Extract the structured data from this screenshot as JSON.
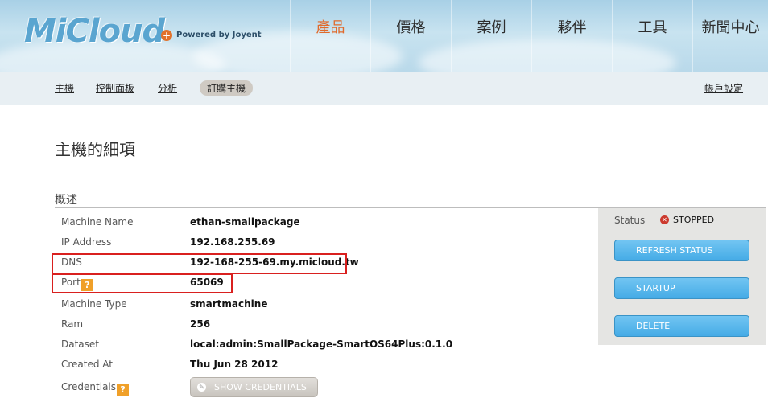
{
  "brand": {
    "logo_text": "MiCloud",
    "powered_by": "Powered by Joyent",
    "accent": "#e06a2c"
  },
  "nav": [
    {
      "label": "產品",
      "active": true
    },
    {
      "label": "價格",
      "active": false
    },
    {
      "label": "案例",
      "active": false
    },
    {
      "label": "夥伴",
      "active": false
    },
    {
      "label": "工具",
      "active": false
    },
    {
      "label": "新聞中心",
      "active": false
    }
  ],
  "subnav": {
    "machines": "主機",
    "control_panel": "控制面板",
    "analytics": "分析",
    "order_machine": "訂購主機",
    "account_settings": "帳戶設定"
  },
  "page": {
    "title": "主機的細項",
    "section": "概述"
  },
  "details": [
    {
      "label": "Machine Name",
      "value": "ethan-smallpackage"
    },
    {
      "label": "IP Address",
      "value": "192.168.255.69"
    },
    {
      "label": "DNS",
      "value": "192-168-255-69.my.micloud.tw"
    },
    {
      "label": "Port",
      "value": "65069",
      "help": "?"
    },
    {
      "label": "Machine Type",
      "value": "smartmachine"
    },
    {
      "label": "Ram",
      "value": "256"
    },
    {
      "label": "Dataset",
      "value": "local:admin:SmallPackage-SmartOS64Plus:0.1.0"
    },
    {
      "label": "Created At",
      "value": "Thu Jun 28 2012"
    },
    {
      "label": "Credentials",
      "help": "?"
    }
  ],
  "credentials_button": "SHOW CREDENTIALS",
  "status": {
    "label": "Status",
    "value": "STOPPED",
    "color": "#cc3a2e",
    "buttons": {
      "refresh": "REFRESH STATUS",
      "startup": "STARTUP",
      "delete": "DELETE"
    }
  }
}
